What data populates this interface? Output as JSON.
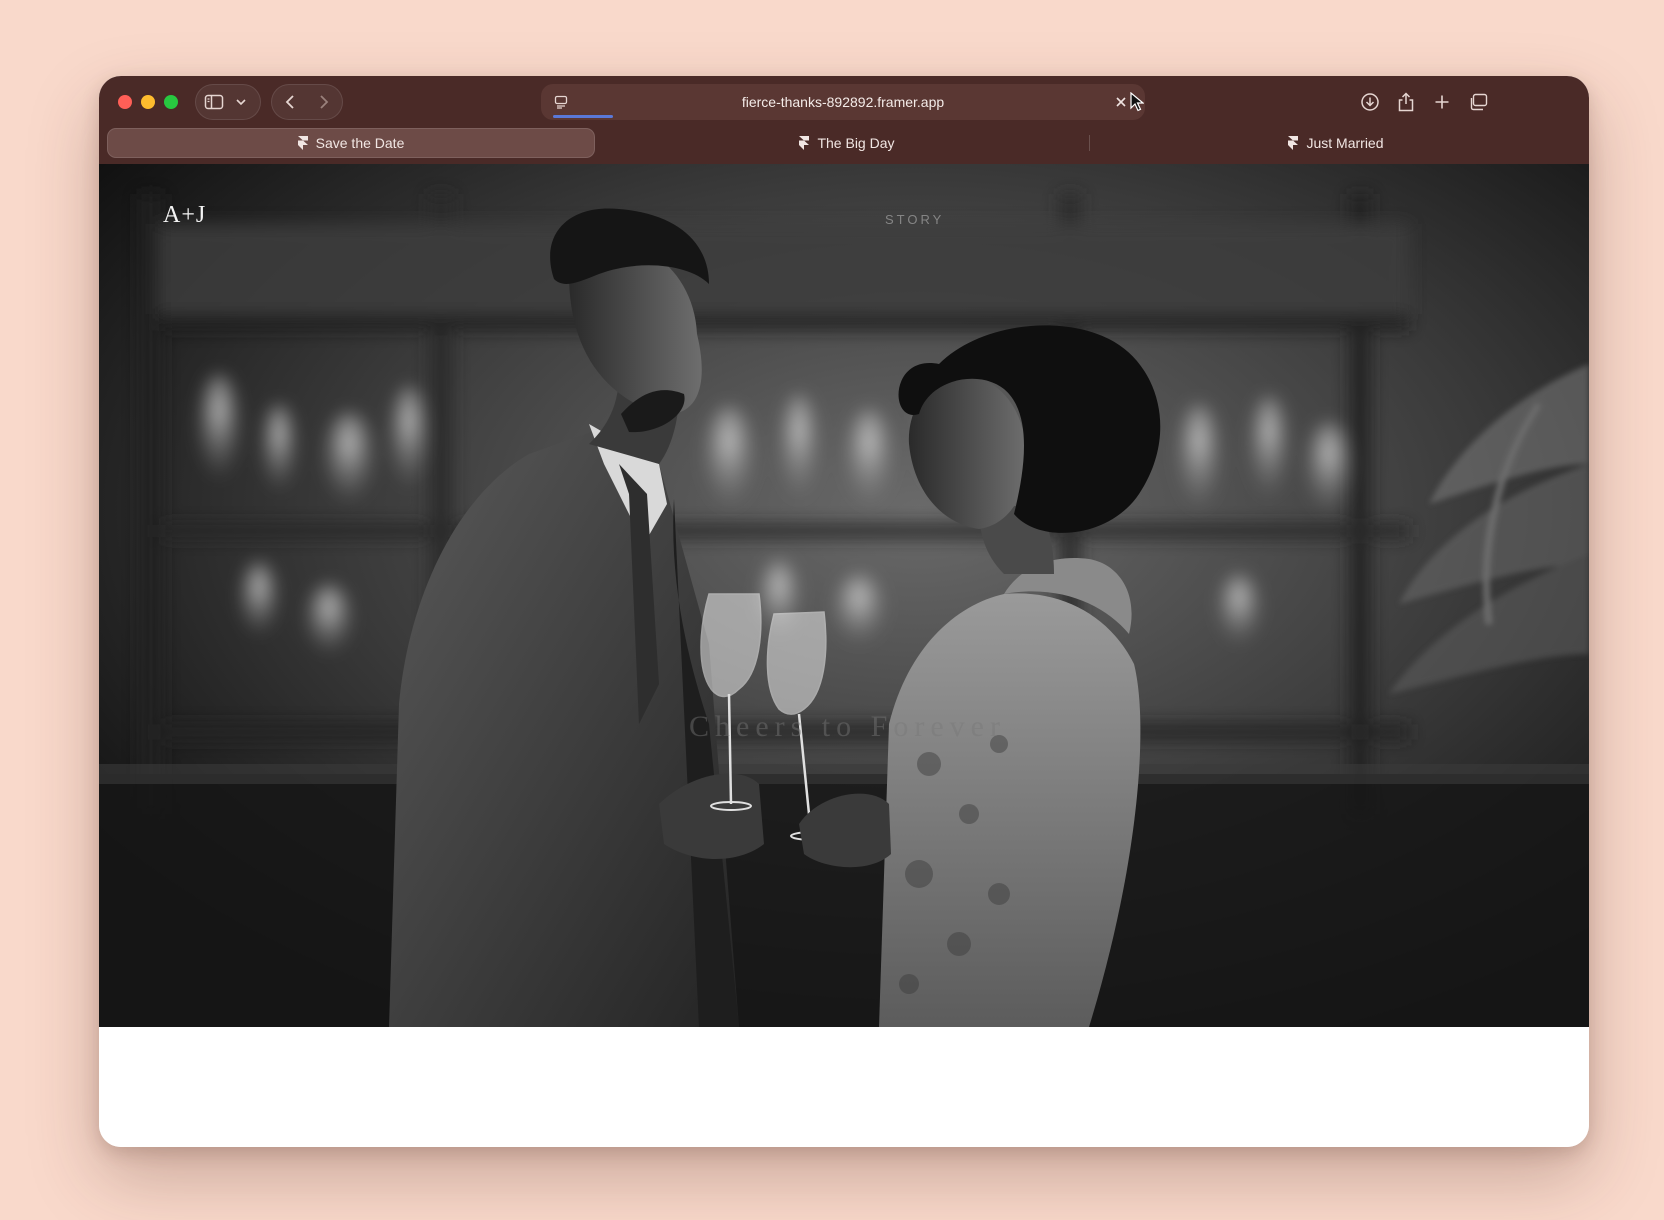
{
  "browser": {
    "url": "fierce-thanks-892892.framer.app",
    "tabs": [
      {
        "label": "Save the Date",
        "active": true
      },
      {
        "label": "The Big Day",
        "active": false
      },
      {
        "label": "Just Married",
        "active": false
      }
    ],
    "icons": {
      "sidebar": "sidebar-icon",
      "chevron": "chevron-down-icon",
      "back": "back-arrow-icon",
      "forward": "forward-arrow-icon",
      "reader": "reader-icon",
      "stop": "close-icon",
      "download": "download-icon",
      "share": "share-icon",
      "new_tab": "plus-icon",
      "tab_overview": "tabs-overview-icon",
      "tab_favicon": "framer-icon"
    }
  },
  "site": {
    "logo": "A+J",
    "nav": {
      "story": "STORY"
    },
    "hero_text": "Cheers to Forever"
  },
  "colors": {
    "page_background": "#f9d9cb",
    "toolbar": "#4a2a27",
    "address_bar": "#5a3733",
    "active_tab": "#6d4b47",
    "progress": "#5a78d8"
  }
}
